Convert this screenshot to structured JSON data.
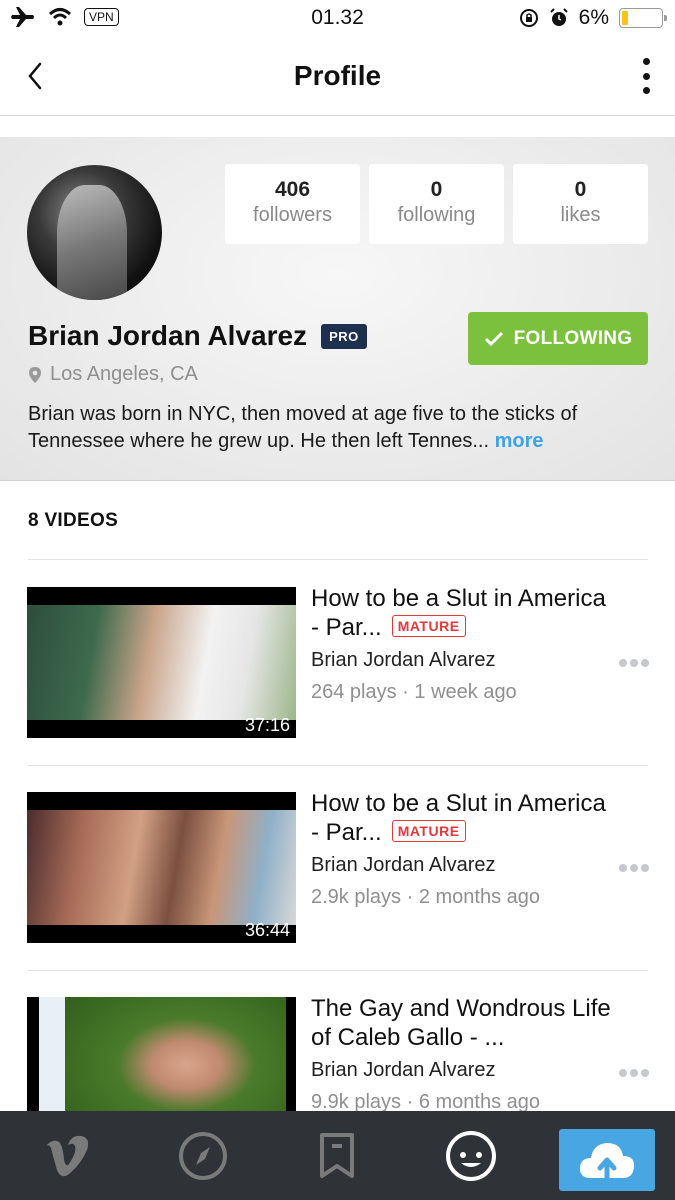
{
  "status_bar": {
    "time": "01.32",
    "vpn_label": "VPN",
    "battery_percent_label": "6%",
    "battery_level": 0.06,
    "icons": [
      "airplane-mode-icon",
      "wifi-icon",
      "vpn-icon",
      "rotation-lock-icon",
      "alarm-icon",
      "battery-icon"
    ]
  },
  "navbar": {
    "title": "Profile",
    "back_icon": "chevron-left-icon",
    "menu_icon": "more-vertical-icon"
  },
  "profile": {
    "name": "Brian Jordan Alvarez",
    "badge": "PRO",
    "location": "Los Angeles, CA",
    "bio": "Brian was born in NYC, then moved at age five to the sticks of Tennessee where he grew up. He then left Tennes...",
    "more_label": "more",
    "follow_button": "FOLLOWING",
    "stats": [
      {
        "value": "406",
        "label": "followers"
      },
      {
        "value": "0",
        "label": "following"
      },
      {
        "value": "0",
        "label": "likes"
      }
    ]
  },
  "videos": {
    "heading": "8 VIDEOS",
    "items": [
      {
        "title": "How to be a Slut in America - Par...",
        "mature": "MATURE",
        "author": "Brian Jordan Alvarez",
        "meta": "264 plays · 1 week ago",
        "duration": "37:16"
      },
      {
        "title": "How to be a Slut in America - Par...",
        "mature": "MATURE",
        "author": "Brian Jordan Alvarez",
        "meta": "2.9k plays · 2 months ago",
        "duration": "36:44"
      },
      {
        "title": "The Gay and Wondrous Life of Caleb Gallo - ...",
        "mature": "",
        "author": "Brian Jordan Alvarez",
        "meta": "9.9k plays · 6 months ago",
        "duration": ""
      }
    ]
  },
  "tabbar": {
    "items": [
      {
        "name": "home",
        "icon": "vimeo-logo-icon"
      },
      {
        "name": "explore",
        "icon": "compass-icon"
      },
      {
        "name": "watchlater",
        "icon": "bookmark-icon"
      },
      {
        "name": "profile",
        "icon": "smiley-face-icon",
        "active": true
      },
      {
        "name": "upload",
        "icon": "cloud-upload-icon"
      }
    ],
    "accent_color": "#48a6e3"
  },
  "colors": {
    "follow_green": "#7bc13e",
    "pro_navy": "#1e3050",
    "mature_red": "#e0393e",
    "link_blue": "#3ca3e6"
  }
}
